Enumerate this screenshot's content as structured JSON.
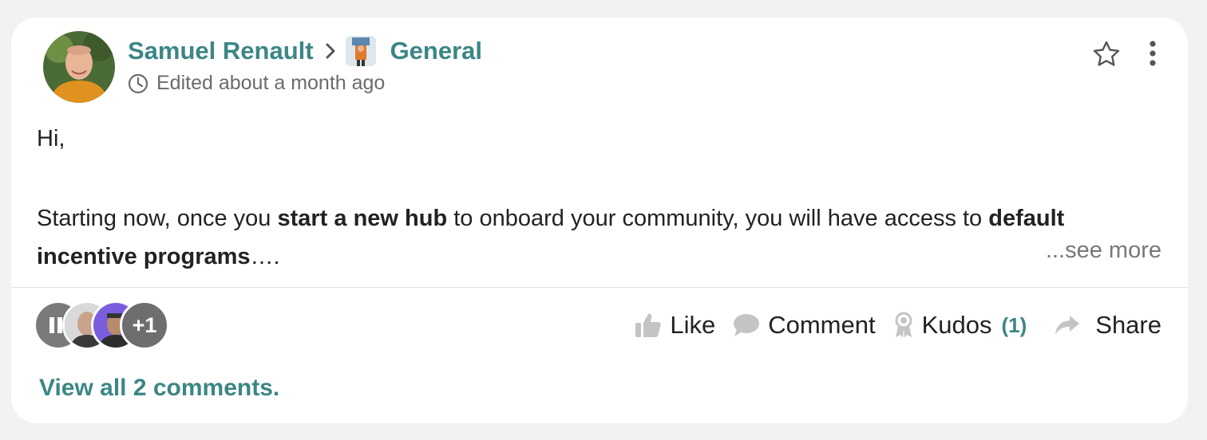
{
  "post": {
    "author": "Samuel Renault",
    "channel": "General",
    "edited": "Edited about a month ago",
    "body": {
      "greeting": "Hi,",
      "p1_a": "Starting now, once you ",
      "p1_b": "start a new hub",
      "p1_c": " to onboard your community, you will have access to ",
      "p1_d": "default incentive programs",
      "p1_e": "…."
    },
    "see_more": "...see more",
    "reactors_more": "+1",
    "actions": {
      "like": "Like",
      "comment": "Comment",
      "kudos": "Kudos",
      "kudos_count": "(1)",
      "share": "Share"
    },
    "view_all_comments": "View all 2 comments."
  },
  "colors": {
    "accent": "#3c8686",
    "background": "#f2f2f2",
    "card": "#ffffff",
    "muted": "#6b6b6b",
    "icon_gray": "#c4c4c4"
  },
  "icons": [
    "chevron-right-icon",
    "clock-icon",
    "star-icon",
    "more-vertical-icon",
    "thumbs-up-icon",
    "comment-bubble-icon",
    "award-icon",
    "share-arrow-icon"
  ]
}
